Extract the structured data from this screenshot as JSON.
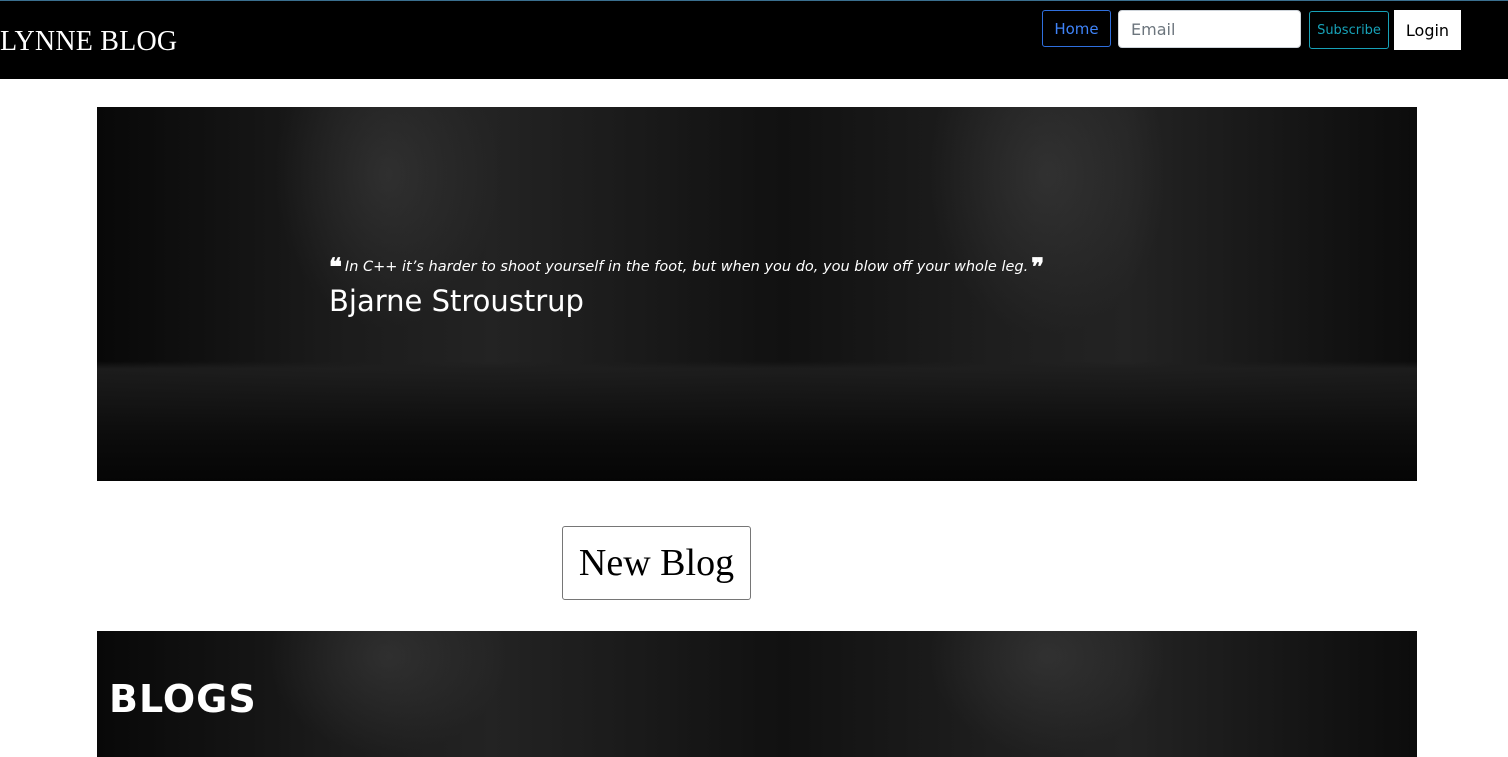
{
  "navbar": {
    "brand": "LYNNE BLOG",
    "home_label": "Home",
    "email_placeholder": "Email",
    "subscribe_label": "Subscribe",
    "login_label": "Login"
  },
  "hero": {
    "quote": "In C++ it’s harder to shoot yourself in the foot, but when you do, you blow off your whole leg.",
    "open_quote_mark": "❝",
    "close_quote_mark": "❞",
    "author": "Bjarne Stroustrup"
  },
  "actions": {
    "new_blog_label": "New Blog"
  },
  "blogs_section": {
    "title": "BLOGS"
  },
  "colors": {
    "navbar_bg": "#000000",
    "home_accent": "#3f83f8",
    "subscribe_accent": "#17a2b8"
  }
}
